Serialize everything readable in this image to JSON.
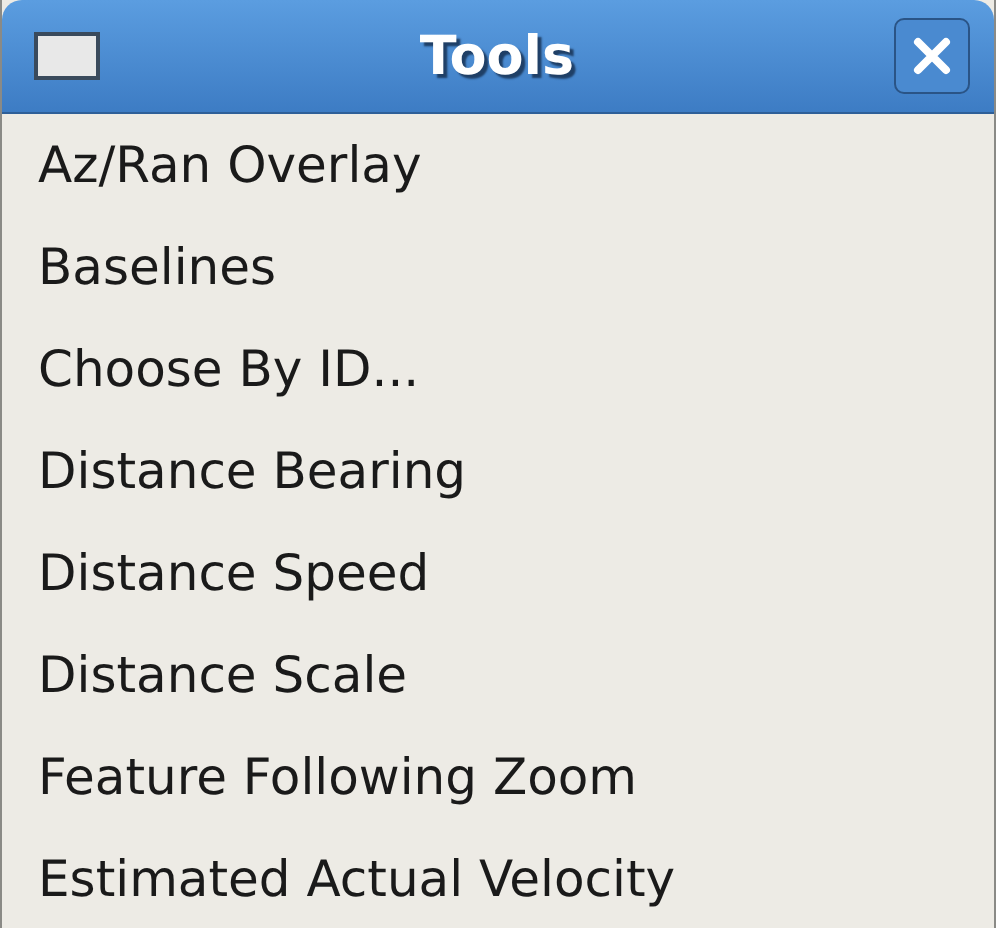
{
  "window": {
    "title": "Tools"
  },
  "items": [
    {
      "label": "Az/Ran Overlay"
    },
    {
      "label": "Baselines"
    },
    {
      "label": "Choose By ID..."
    },
    {
      "label": "Distance Bearing"
    },
    {
      "label": "Distance Speed"
    },
    {
      "label": "Distance Scale"
    },
    {
      "label": "Feature Following Zoom"
    },
    {
      "label": "Estimated Actual Velocity"
    }
  ]
}
